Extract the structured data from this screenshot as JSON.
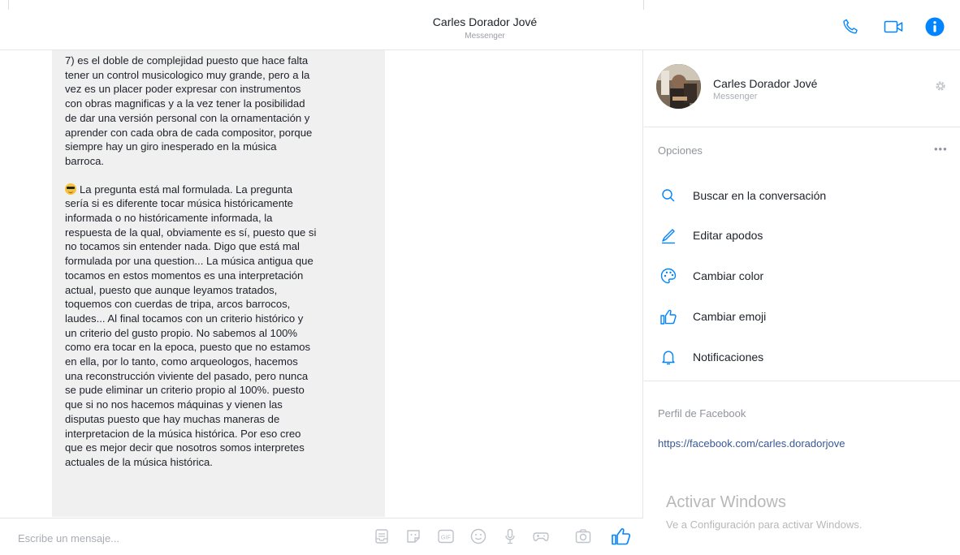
{
  "header": {
    "title": "Carles Dorador Jové",
    "subtitle": "Messenger",
    "accent_color": "#0084ff",
    "icons": [
      "phone-icon",
      "video-camera-icon",
      "info-icon"
    ]
  },
  "conversation": {
    "message_paragraph_1": "7) es el doble de complejidad puesto que hace falta\ntener un control musicologico muy grande, pero a la\nvez es un placer poder expresar con instrumentos\ncon obras magnificas y a la vez tener la posibilidad\nde dar una versión personal con la ornamentación y\naprender con cada obra de cada compositor, porque\nsiempre hay un giro inesperado en la música\nbarroca.",
    "message_emoji": "sunglasses-emoji",
    "message_paragraph_2": "La pregunta está mal formulada. La pregunta\nsería si es diferente tocar música históricamente\ninformada o no históricamente informada, la\nrespuesta de la qual, obviamente es sí, puesto que si\nno tocamos sin entender nada. Digo que está mal\nformulada por una question... La música antigua que\ntocamos en estos momentos es una interpretación\nactual, puesto que aunque leyamos tratados,\ntoquemos con cuerdas de tripa, arcos barrocos,\nlaudes... Al final tocamos con un criterio histórico y\nun criterio del gusto propio. No sabemos al 100%\ncomo era tocar en la epoca, puesto que no estamos\nen ella, por lo tanto, como arqueologos, hacemos\nuna reconstrucción viviente del pasado, pero nunca\nse pude eliminar un criterio propio al 100%. puesto\nque si no nos hacemos máquinas y vienen las\ndisputas puesto que hay muchas maneras de\ninterpretacion de la música histórica. Por eso creo\nque es mejor decir que nosotros somos interpretes\nactuales de la música histórica."
  },
  "composer": {
    "placeholder": "Escribe un mensaje...",
    "tools": [
      "file-icon",
      "sticker-icon",
      "gif-icon",
      "emoji-icon",
      "microphone-icon",
      "game-icon",
      "camera-icon",
      "like-icon"
    ],
    "gif_label": "GIF"
  },
  "sidebar": {
    "name": "Carles Dorador Jové",
    "subtitle": "Messenger",
    "options_heading": "Opciones",
    "more": "•••",
    "options": [
      {
        "label": "Buscar en la conversación",
        "icon": "search-icon"
      },
      {
        "label": "Editar apodos",
        "icon": "pencil-icon"
      },
      {
        "label": "Cambiar color",
        "icon": "palette-icon"
      },
      {
        "label": "Cambiar emoji",
        "icon": "thumbs-up-icon"
      },
      {
        "label": "Notificaciones",
        "icon": "bell-icon"
      }
    ],
    "facebook_heading": "Perfil de Facebook",
    "facebook_link": "https://facebook.com/carles.doradorjove"
  },
  "watermark": {
    "title": "Activar Windows",
    "subtitle": "Ve a Configuración para activar Windows."
  }
}
